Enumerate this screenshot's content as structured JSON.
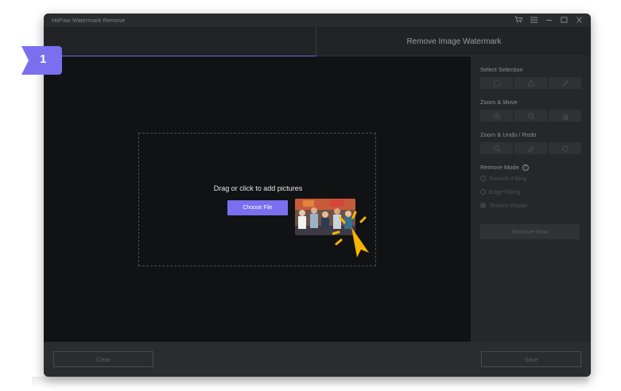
{
  "app": {
    "title": "HitPaw Watermark Remove",
    "controls": [
      "cart-icon",
      "menu-icon",
      "minimize-icon",
      "maximize-icon",
      "close-icon"
    ]
  },
  "tabs": {
    "right_label": "Remove Image Watermark"
  },
  "step": {
    "number": "1"
  },
  "canvas": {
    "drop_text": "Drag or click to add pictures",
    "choose_label": "Choose File"
  },
  "panel": {
    "select_selection": "Select Selection",
    "zoom_move": "Zoom & Move",
    "zoom_undo_redo": "Zoom & Undo / Redo",
    "remove_mode": "Remove Mode",
    "modes": [
      "Smooth Filling",
      "Edge Filling",
      "Texture Repair"
    ],
    "selected_mode": "Texture Repair",
    "remove_now": "Remove Now"
  },
  "footer": {
    "clear_label": "Clear",
    "save_label": "Save"
  },
  "colors": {
    "accent": "#7b6ff0",
    "background": "#1b1c1e",
    "cursor": "#f7b500"
  }
}
